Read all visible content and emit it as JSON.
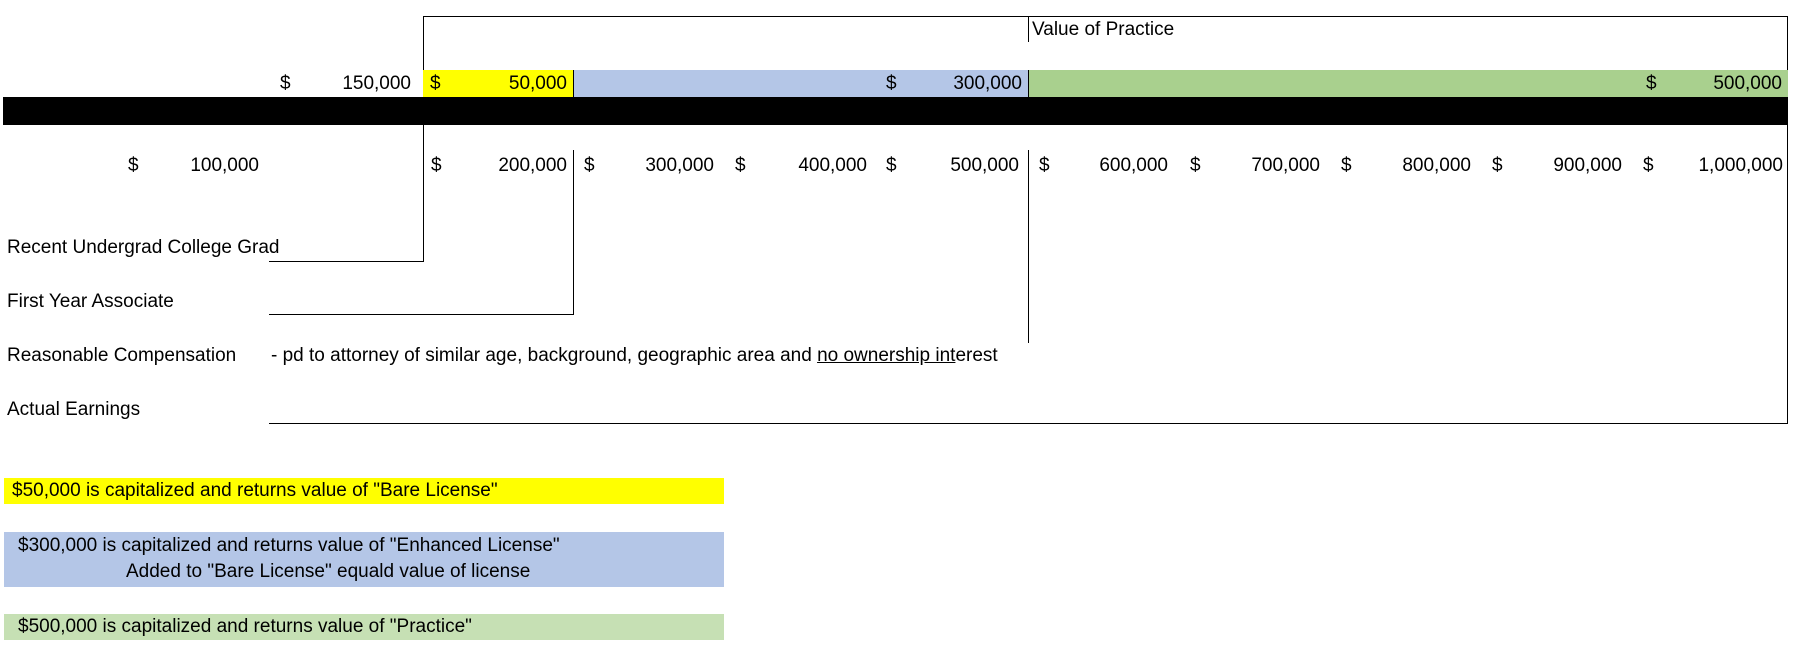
{
  "header": {
    "title": "Value of Practice"
  },
  "colors": {
    "bare": "#ffff00",
    "enhanced": "#b4c6e7",
    "practice": "#a9d08e",
    "practice_light": "#c6e0b4",
    "bar": "#000000"
  },
  "bands": {
    "left": {
      "cur": "$",
      "amt": "150,000"
    },
    "bare": {
      "cur": "$",
      "amt": "50,000"
    },
    "enhanced": {
      "cur": "$",
      "amt": "300,000"
    },
    "practice": {
      "cur": "$",
      "amt": "500,000"
    }
  },
  "scale": [
    {
      "cur": "$",
      "amt": "100,000"
    },
    {
      "cur": "$",
      "amt": "200,000"
    },
    {
      "cur": "$",
      "amt": "300,000"
    },
    {
      "cur": "$",
      "amt": "400,000"
    },
    {
      "cur": "$",
      "amt": "500,000"
    },
    {
      "cur": "$",
      "amt": "600,000"
    },
    {
      "cur": "$",
      "amt": "700,000"
    },
    {
      "cur": "$",
      "amt": "800,000"
    },
    {
      "cur": "$",
      "amt": "900,000"
    },
    {
      "cur": "$",
      "amt": "1,000,000"
    }
  ],
  "rows": {
    "grad": "Recent Undergrad College Grad",
    "associate": "First Year Associate",
    "reasonable": "Reasonable Compensation",
    "reasonable_note_a": "- pd to attorney of similar age, background, geographic area and ",
    "reasonable_note_b": "no ownership int",
    "reasonable_note_c": "erest",
    "actual": "Actual Earnings"
  },
  "notes": {
    "bare": "$50,000 is capitalized and returns value of \"Bare License\"",
    "enhanced_1": "$300,000 is capitalized and returns value of \"Enhanced License\"",
    "enhanced_2": "Added to \"Bare License\" equald value of license",
    "practice": "$500,000 is capitalized and returns value of \"Practice\""
  }
}
